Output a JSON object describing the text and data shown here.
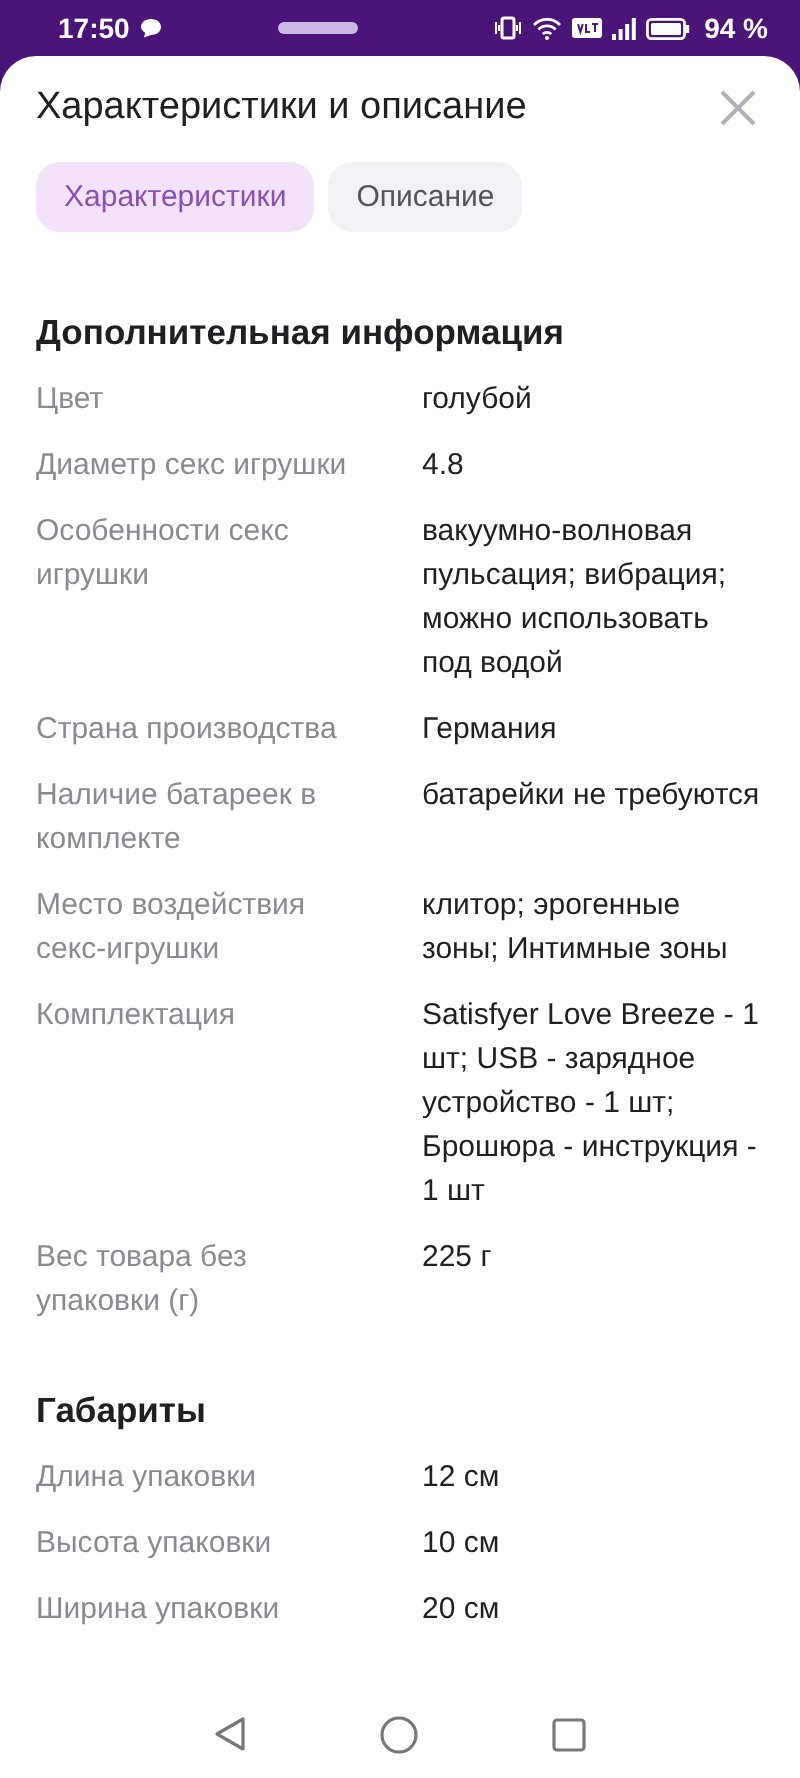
{
  "status_bar": {
    "time": "17:50",
    "battery": "94 %"
  },
  "sheet": {
    "title": "Характеристики и описание",
    "tabs": [
      {
        "label": "Характеристики",
        "selected": true
      },
      {
        "label": "Описание",
        "selected": false
      }
    ],
    "sections": [
      {
        "heading": "Дополнительная информация",
        "rows": [
          {
            "name": "Цвет",
            "value": "голубой"
          },
          {
            "name": "Диаметр секс игрушки",
            "value": "4.8"
          },
          {
            "name": "Особенности секс игрушки",
            "value": "вакуумно-волновая пульсация; вибрация; можно использовать под водой"
          },
          {
            "name": "Страна производства",
            "value": "Германия"
          },
          {
            "name": "Наличие батареек в комплекте",
            "value": "батарейки не требуются"
          },
          {
            "name": "Место воздействия секс-игрушки",
            "value": "клитор; эрогенные зоны; Интимные зоны"
          },
          {
            "name": "Комплектация",
            "value": "Satisfyer Love Breeze - 1 шт; USB - зарядное устройство - 1 шт; Брошюра - инструкция - 1 шт"
          },
          {
            "name": "Вес товара без упаковки (г)",
            "value": "225 г"
          }
        ]
      },
      {
        "heading": "Габариты",
        "rows": [
          {
            "name": "Длина упаковки",
            "value": "12 см"
          },
          {
            "name": "Высота упаковки",
            "value": "10 см"
          },
          {
            "name": "Ширина упаковки",
            "value": "20 см"
          }
        ]
      }
    ]
  }
}
